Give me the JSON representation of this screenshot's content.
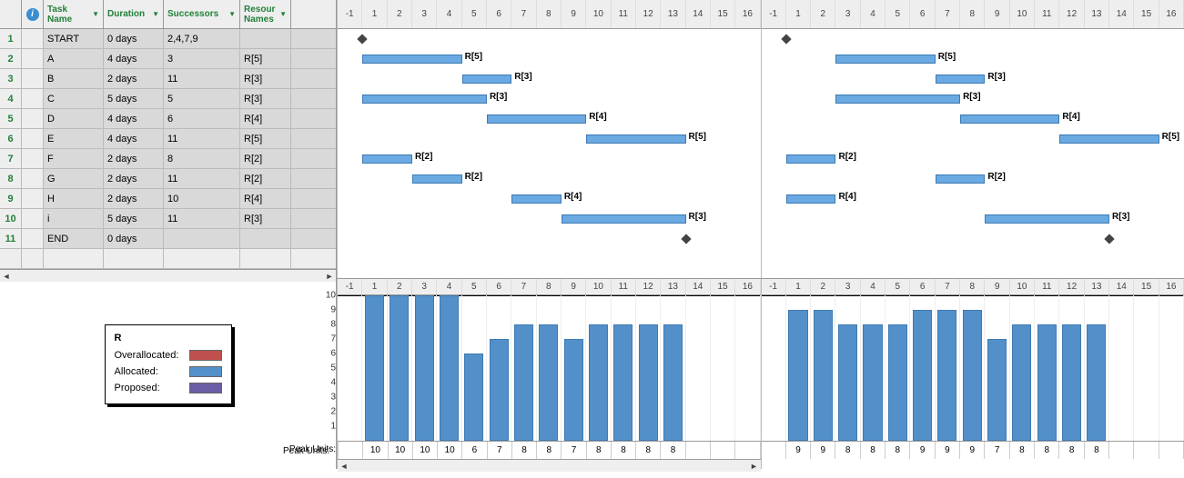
{
  "table": {
    "headers": {
      "info": "",
      "name": "Task Name",
      "duration": "Duration",
      "successors": "Successors",
      "resources": "Resour Names"
    },
    "rows": [
      {
        "num": "1",
        "name": "START",
        "duration": "0 days",
        "successors": "2,4,7,9",
        "resources": ""
      },
      {
        "num": "2",
        "name": "A",
        "duration": "4 days",
        "successors": "3",
        "resources": "R[5]"
      },
      {
        "num": "3",
        "name": "B",
        "duration": "2 days",
        "successors": "11",
        "resources": "R[3]"
      },
      {
        "num": "4",
        "name": "C",
        "duration": "5 days",
        "successors": "5",
        "resources": "R[3]"
      },
      {
        "num": "5",
        "name": "D",
        "duration": "4 days",
        "successors": "6",
        "resources": "R[4]"
      },
      {
        "num": "6",
        "name": "E",
        "duration": "4 days",
        "successors": "11",
        "resources": "R[5]"
      },
      {
        "num": "7",
        "name": "F",
        "duration": "2 days",
        "successors": "8",
        "resources": "R[2]"
      },
      {
        "num": "8",
        "name": "G",
        "duration": "2 days",
        "successors": "11",
        "resources": "R[2]"
      },
      {
        "num": "9",
        "name": "H",
        "duration": "2 days",
        "successors": "10",
        "resources": "R[4]"
      },
      {
        "num": "10",
        "name": "i",
        "duration": "5 days",
        "successors": "11",
        "resources": "R[3]"
      },
      {
        "num": "11",
        "name": "END",
        "duration": "0 days",
        "successors": "",
        "resources": ""
      }
    ]
  },
  "timescale": [
    "-1",
    "1",
    "2",
    "3",
    "4",
    "5",
    "6",
    "7",
    "8",
    "9",
    "10",
    "11",
    "12",
    "13",
    "14",
    "15",
    "16"
  ],
  "gantt_left": {
    "bars": [
      {
        "row": 0,
        "start": 1,
        "len": 0,
        "type": "milestone",
        "label": ""
      },
      {
        "row": 1,
        "start": 1,
        "len": 4,
        "label": "R[5]"
      },
      {
        "row": 2,
        "start": 5,
        "len": 2,
        "label": "R[3]"
      },
      {
        "row": 3,
        "start": 1,
        "len": 5,
        "label": "R[3]"
      },
      {
        "row": 4,
        "start": 6,
        "len": 4,
        "label": "R[4]"
      },
      {
        "row": 5,
        "start": 10,
        "len": 4,
        "label": "R[5]"
      },
      {
        "row": 6,
        "start": 1,
        "len": 2,
        "label": "R[2]"
      },
      {
        "row": 7,
        "start": 3,
        "len": 2,
        "label": "R[2]"
      },
      {
        "row": 8,
        "start": 7,
        "len": 2,
        "label": "R[4]"
      },
      {
        "row": 9,
        "start": 9,
        "len": 5,
        "label": "R[3]"
      },
      {
        "row": 10,
        "start": 14,
        "len": 0,
        "type": "milestone",
        "label": ""
      }
    ]
  },
  "gantt_right": {
    "bars": [
      {
        "row": 0,
        "start": 1,
        "len": 0,
        "type": "milestone",
        "label": ""
      },
      {
        "row": 1,
        "start": 3,
        "len": 4,
        "label": "R[5]"
      },
      {
        "row": 2,
        "start": 7,
        "len": 2,
        "label": "R[3]"
      },
      {
        "row": 3,
        "start": 3,
        "len": 5,
        "label": "R[3]"
      },
      {
        "row": 4,
        "start": 8,
        "len": 4,
        "label": "R[4]"
      },
      {
        "row": 5,
        "start": 12,
        "len": 4,
        "label": "R[5]"
      },
      {
        "row": 6,
        "start": 1,
        "len": 2,
        "label": "R[2]"
      },
      {
        "row": 7,
        "start": 7,
        "len": 2,
        "label": "R[2]"
      },
      {
        "row": 8,
        "start": 1,
        "len": 2,
        "label": "R[4]"
      },
      {
        "row": 9,
        "start": 9,
        "len": 5,
        "label": "R[3]"
      },
      {
        "row": 10,
        "start": 14,
        "len": 0,
        "type": "milestone",
        "label": ""
      }
    ]
  },
  "legend": {
    "title": "R",
    "rows": [
      {
        "label": "Overallocated:",
        "color": "#c0504d"
      },
      {
        "label": "Allocated:",
        "color": "#5390c9"
      },
      {
        "label": "Proposed:",
        "color": "#6b5ca5"
      }
    ]
  },
  "histogram_footer_label": "Peak Units:",
  "chart_data": [
    {
      "type": "bar",
      "title": "",
      "xlabel": "",
      "ylabel": "",
      "categories": [
        "-1",
        "1",
        "2",
        "3",
        "4",
        "5",
        "6",
        "7",
        "8",
        "9",
        "10",
        "11",
        "12",
        "13",
        "14",
        "15",
        "16"
      ],
      "values": [
        null,
        10,
        10,
        10,
        10,
        6,
        7,
        8,
        8,
        7,
        8,
        8,
        8,
        8,
        null,
        null,
        null
      ],
      "ylim": [
        0,
        10
      ]
    },
    {
      "type": "bar",
      "title": "",
      "xlabel": "",
      "ylabel": "",
      "categories": [
        "-1",
        "1",
        "2",
        "3",
        "4",
        "5",
        "6",
        "7",
        "8",
        "9",
        "10",
        "11",
        "12",
        "13",
        "14",
        "15",
        "16"
      ],
      "values": [
        null,
        9,
        9,
        8,
        8,
        8,
        9,
        9,
        9,
        7,
        8,
        8,
        8,
        8,
        null,
        null,
        null
      ],
      "ylim": [
        0,
        10
      ]
    }
  ]
}
